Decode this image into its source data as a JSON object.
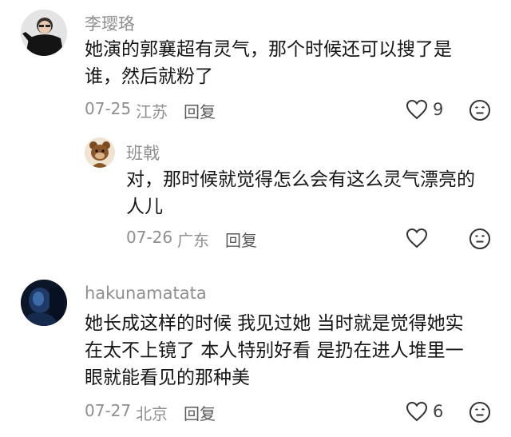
{
  "comments": [
    {
      "username": "李璎珞",
      "text": "她演的郭襄超有灵气，那个时候还可以搜了是谁，然后就粉了",
      "date": "07-25",
      "location": "江苏",
      "reply_label": "回复",
      "likes": "9",
      "avatar_icon": "person-in-black-avatar",
      "replies": [
        {
          "username": "班戟",
          "text": "对，那时候就觉得怎么会有这么灵气漂亮的人儿",
          "date": "07-26",
          "location": "广东",
          "reply_label": "回复",
          "avatar_icon": "brown-bear-avatar"
        }
      ]
    },
    {
      "username": "hakunamatata",
      "text": "她长成这样的时候 我见过她 当时就是觉得她实在太不上镜了 本人特别好看 是扔在进人堆里一眼就能看见的那种美",
      "date": "07-27",
      "location": "北京",
      "reply_label": "回复",
      "likes": "6",
      "avatar_icon": "dark-blue-night-avatar"
    }
  ],
  "colors": {
    "meta": "#8f8f8f",
    "text": "#161616",
    "icon": "#333333"
  }
}
